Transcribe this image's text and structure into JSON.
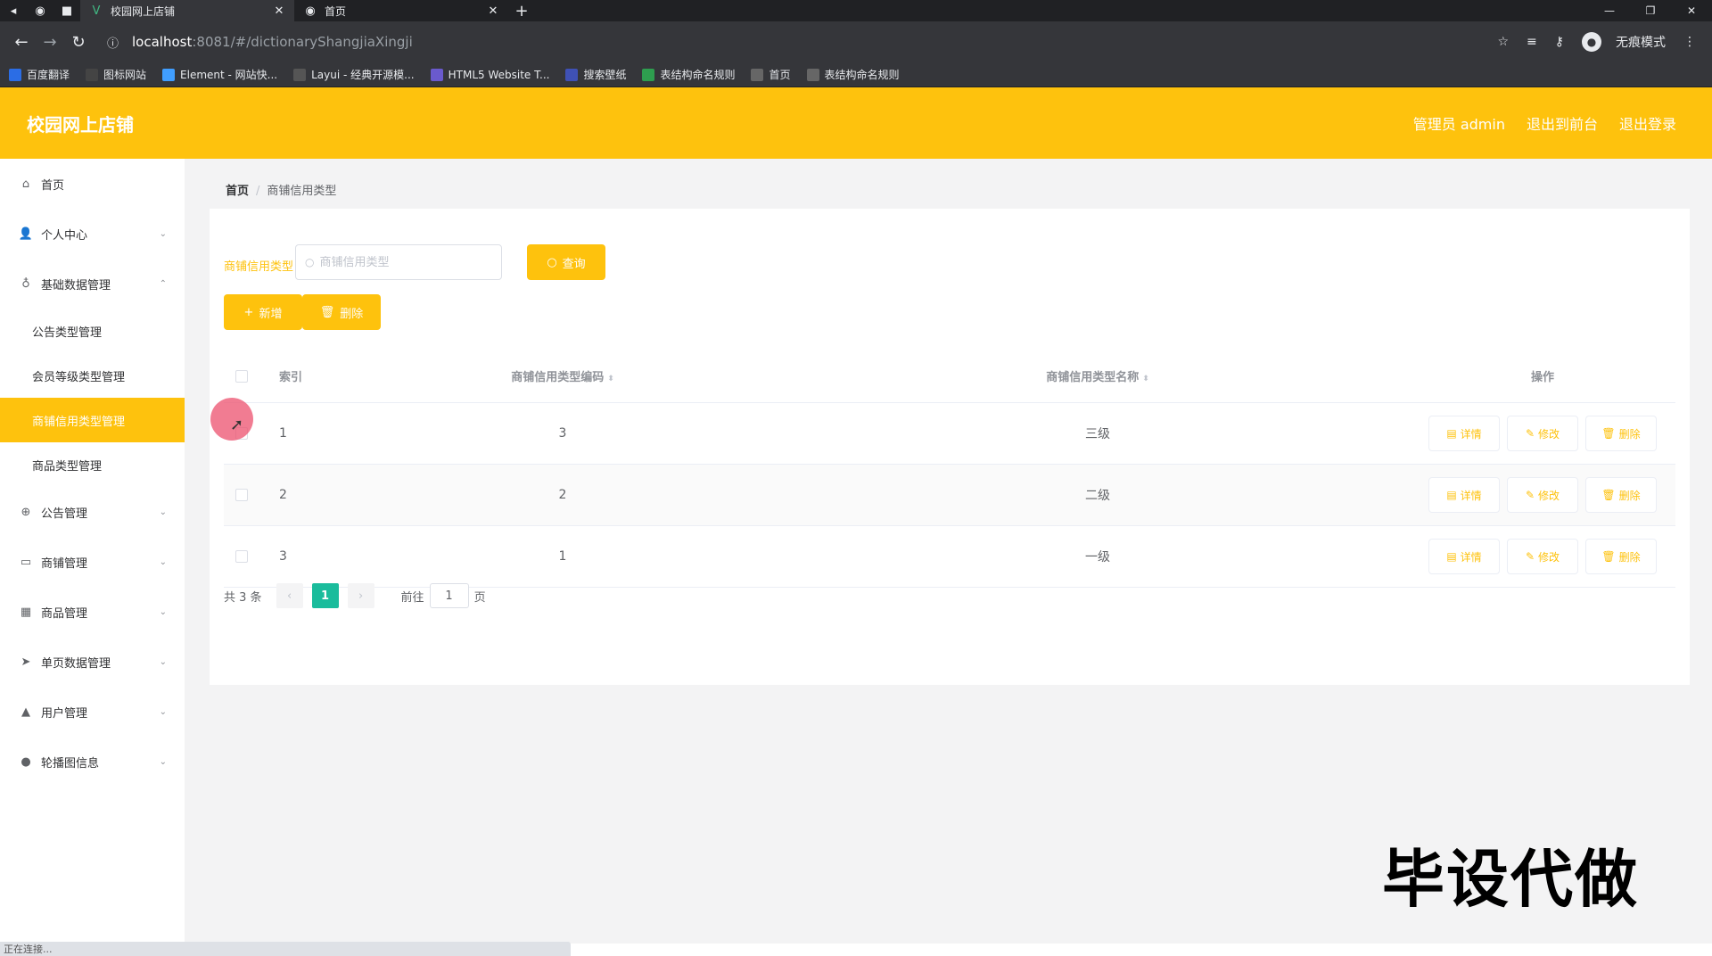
{
  "browser": {
    "tabs": [
      {
        "title": "校园网上店铺",
        "icon": "vue-logo-icon",
        "active": true
      },
      {
        "title": "首页",
        "icon": "globe-icon",
        "active": false
      }
    ],
    "url_host": "localhost",
    "url_path": ":8081/#/dictionaryShangjiaXingji",
    "profile_label": "无痕模式",
    "bookmarks": [
      {
        "label": "百度翻译",
        "color": "#2b6de5"
      },
      {
        "label": "图标网站",
        "color": "#444444"
      },
      {
        "label": "Element - 网站快...",
        "color": "#409eff"
      },
      {
        "label": "Layui - 经典开源模...",
        "color": "#555555"
      },
      {
        "label": "HTML5 Website T...",
        "color": "#6a5acd"
      },
      {
        "label": "搜索壁纸",
        "color": "#3f51b5"
      },
      {
        "label": "表结构命名规则",
        "color": "#2e9e4f"
      },
      {
        "label": "首页",
        "color": "#666666"
      },
      {
        "label": "表结构命名规则",
        "color": "#666666"
      }
    ]
  },
  "header": {
    "title": "校园网上店铺",
    "admin": "管理员 admin",
    "exit_front": "退出到前台",
    "logout": "退出登录",
    "brand_color": "#fec20d"
  },
  "sidebar": {
    "items": [
      {
        "label": "首页",
        "icon": "home-icon"
      },
      {
        "label": "个人中心",
        "icon": "user-icon"
      },
      {
        "label": "基础数据管理",
        "icon": "mic-icon",
        "expanded": true,
        "children": [
          "公告类型管理",
          "会员等级类型管理",
          "商铺信用类型管理",
          "商品类型管理"
        ]
      },
      {
        "label": "公告管理",
        "icon": "compass-icon"
      },
      {
        "label": "商铺管理",
        "icon": "chat-icon"
      },
      {
        "label": "商品管理",
        "icon": "grid-icon"
      },
      {
        "label": "单页数据管理",
        "icon": "send-icon"
      },
      {
        "label": "用户管理",
        "icon": "thumb-icon"
      },
      {
        "label": "轮播图信息",
        "icon": "location-icon"
      }
    ],
    "active_child": "商铺信用类型管理"
  },
  "breadcrumb": {
    "home": "首页",
    "sep": "/",
    "current": "商铺信用类型"
  },
  "search": {
    "label": "商铺信用类型",
    "placeholder": "商铺信用类型",
    "query_button": "查询"
  },
  "actions": {
    "add": "新增",
    "delete": "删除"
  },
  "table": {
    "headers": {
      "index": "索引",
      "code": "商铺信用类型编码",
      "name": "商铺信用类型名称",
      "ops": "操作"
    },
    "rows": [
      {
        "index": "1",
        "code": "3",
        "name": "三级"
      },
      {
        "index": "2",
        "code": "2",
        "name": "二级"
      },
      {
        "index": "3",
        "code": "1",
        "name": "一级"
      }
    ],
    "ops": {
      "detail": "详情",
      "edit": "修改",
      "delete": "删除"
    }
  },
  "pagination": {
    "total": "共 3 条",
    "current": "1",
    "goto_prefix": "前往",
    "goto_value": "1",
    "goto_suffix": "页"
  },
  "watermark": "毕设代做",
  "statusbar": "正在连接..."
}
